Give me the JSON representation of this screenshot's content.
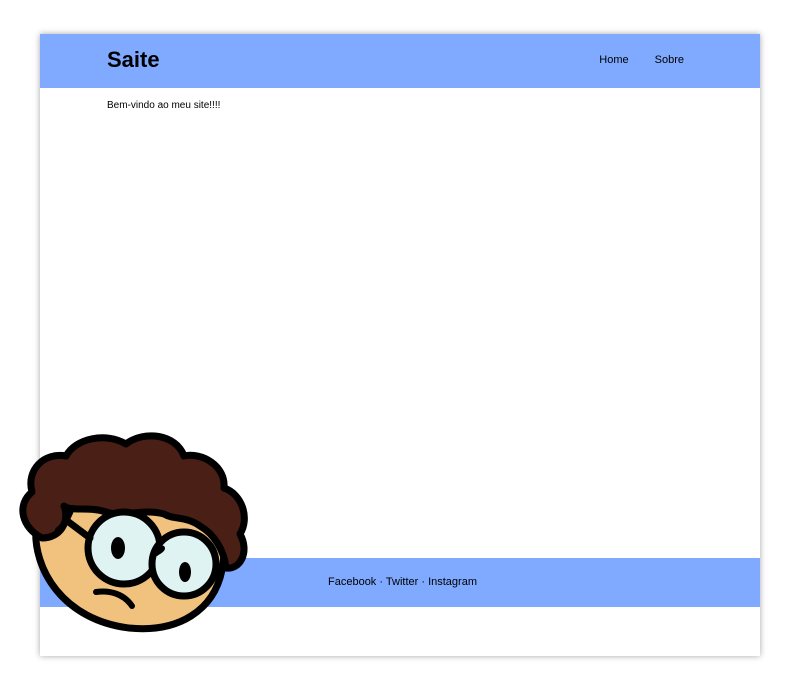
{
  "header": {
    "logo": "Saite",
    "nav": [
      {
        "label": "Home"
      },
      {
        "label": "Sobre"
      }
    ]
  },
  "main": {
    "welcome_text": "Bem-vindo ao meu site!!!!"
  },
  "footer": {
    "links": [
      {
        "label": "Facebook"
      },
      {
        "label": "Twitter"
      },
      {
        "label": "Instagram"
      }
    ],
    "separator": " · "
  },
  "colors": {
    "bar_background": "#7faaff",
    "page_background": "#ffffff",
    "hair": "#4a1f16",
    "skin": "#f0c27e",
    "lens": "#dff3f3"
  },
  "mascot": {
    "icon": "cartoon-boy-with-glasses-icon"
  }
}
